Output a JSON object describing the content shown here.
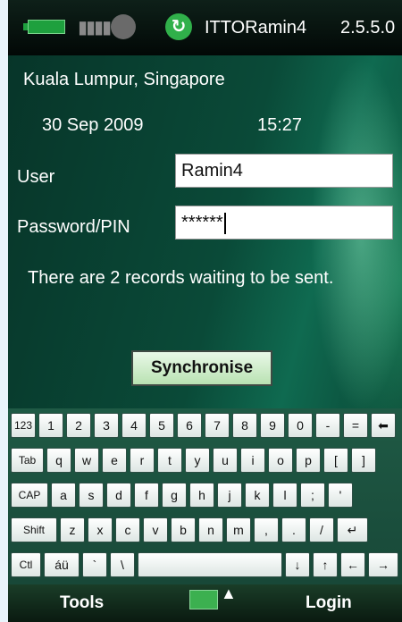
{
  "status_bar": {
    "app_title": "ITTORamin4",
    "version": "2.5.5.0",
    "icons": [
      "battery-icon",
      "signal-icon",
      "volume-icon",
      "sync-icon"
    ]
  },
  "main": {
    "location": "Kuala Lumpur, Singapore",
    "date": "30 Sep 2009",
    "time": "15:27",
    "user_label": "User",
    "user_value": "Ramin4",
    "password_label": "Password/PIN",
    "password_value": "******",
    "records_status": "There are 2 records waiting to be sent.",
    "sync_button": "Synchronise"
  },
  "keyboard": {
    "rows": [
      [
        "123",
        "1",
        "2",
        "3",
        "4",
        "5",
        "6",
        "7",
        "8",
        "9",
        "0",
        "-",
        "=",
        "⬅"
      ],
      [
        "Tab",
        "q",
        "w",
        "e",
        "r",
        "t",
        "y",
        "u",
        "i",
        "o",
        "p",
        "[",
        "]"
      ],
      [
        "CAP",
        "a",
        "s",
        "d",
        "f",
        "g",
        "h",
        "j",
        "k",
        "l",
        ";",
        "'"
      ],
      [
        "Shift",
        "z",
        "x",
        "c",
        "v",
        "b",
        "n",
        "m",
        ",",
        ".",
        "/",
        "↵"
      ],
      [
        "Ctl",
        "áü",
        "`",
        "\\",
        "",
        "↓",
        "↑",
        "←",
        "→"
      ]
    ]
  },
  "soft_keys": {
    "left": "Tools",
    "right": "Login",
    "center_arrow": "▲"
  }
}
